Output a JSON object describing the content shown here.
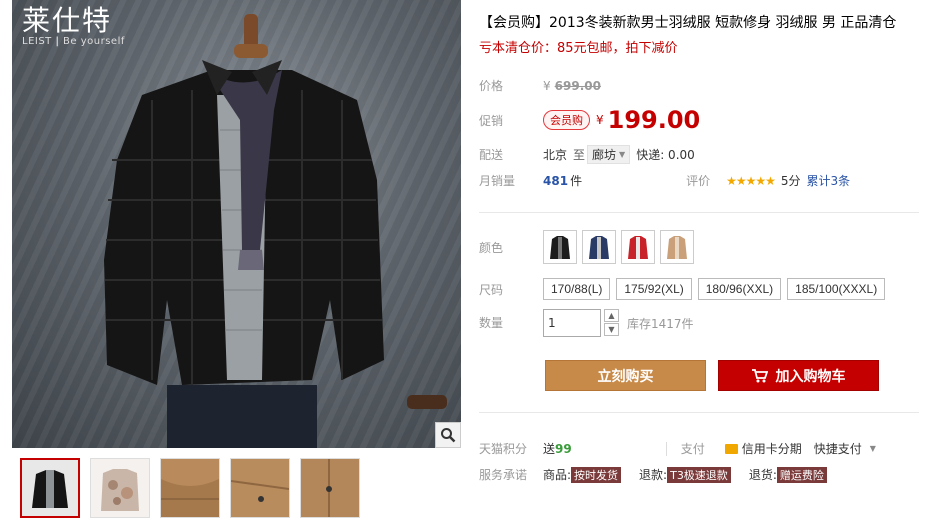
{
  "brand": {
    "name_cn": "莱仕特",
    "name_en_a": "LEIST",
    "name_en_b": "Be yourself"
  },
  "product": {
    "title": "【会员购】2013冬装新款男士羽绒服 短款修身 羽绒服 男 正品清仓",
    "subtitle": "亏本清仓价：85元包邮，拍下减价"
  },
  "price": {
    "label": "价格",
    "currency": "¥",
    "original": "699.00"
  },
  "promo": {
    "label": "促销",
    "tag": "会员购",
    "currency": "¥",
    "value": "199.00"
  },
  "shipping": {
    "label": "配送",
    "from": "北京",
    "to_word": "至",
    "city": "廊坊",
    "express": "快递: 0.00"
  },
  "sales": {
    "label": "月销量",
    "count": "481",
    "unit": "件",
    "review_label": "评价",
    "stars": "★★★★★",
    "score": "5分",
    "review_link": "累计3条"
  },
  "colors": {
    "label": "颜色",
    "swatches": [
      {
        "name": "black",
        "hex": "#1c1c1c"
      },
      {
        "name": "navy",
        "hex": "#2a3b66"
      },
      {
        "name": "red",
        "hex": "#c8232a"
      },
      {
        "name": "khaki",
        "hex": "#c9a07a"
      }
    ]
  },
  "sizes": {
    "label": "尺码",
    "options": [
      "170/88(L)",
      "175/92(XL)",
      "180/96(XXL)",
      "185/100(XXXL)"
    ]
  },
  "quantity": {
    "label": "数量",
    "value": "1",
    "stock": "库存1417件"
  },
  "actions": {
    "buy_now": "立刻购买",
    "add_to_cart": "加入购物车"
  },
  "services": {
    "points_label": "天猫积分",
    "points_prefix": "送",
    "points_value": "99",
    "pay_label": "支付",
    "credit_card": "信用卡分期",
    "quick_pay": "快捷支付",
    "promise_label": "服务承诺",
    "goods_label": "商品:",
    "goods_tag": "按时发货",
    "refund_label": "退款:",
    "refund_tag": "T3极速退款",
    "return_label": "退货:",
    "return_tag": "赠运费险"
  },
  "gallery": {
    "thumbnails": [
      "black-jacket-front",
      "camo-lining",
      "khaki-collar",
      "khaki-detail-1",
      "khaki-detail-2"
    ]
  }
}
